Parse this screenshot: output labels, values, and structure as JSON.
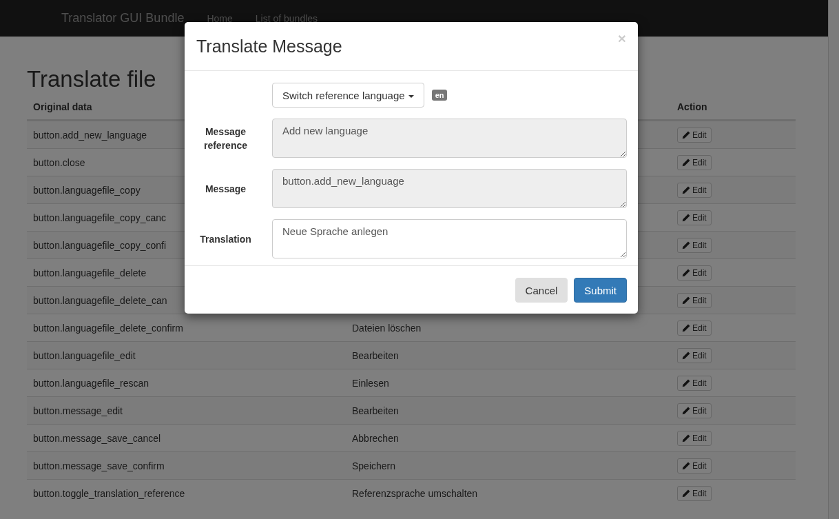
{
  "navbar": {
    "brand": "Translator GUI Bundle",
    "links": [
      {
        "label": "Home"
      },
      {
        "label": "List of bundles"
      }
    ]
  },
  "page": {
    "title": "Translate file",
    "table": {
      "columns": [
        {
          "label": "Original data"
        },
        {
          "label": "Action"
        }
      ],
      "rows": [
        {
          "original": "button.add_new_language",
          "action": "Edit"
        },
        {
          "original": "button.close",
          "action": "Edit"
        },
        {
          "original": "button.languagefile_copy",
          "action": "Edit"
        },
        {
          "original": "button.languagefile_copy_canc",
          "action": "Edit"
        },
        {
          "original": "button.languagefile_copy_confi",
          "action": "Edit"
        },
        {
          "original": "button.languagefile_delete",
          "action": "Edit"
        },
        {
          "original": "button.languagefile_delete_can",
          "action": "Edit"
        },
        {
          "original": "button.languagefile_delete_confirm",
          "translation": "Dateien löschen",
          "action": "Edit"
        },
        {
          "original": "button.languagefile_edit",
          "translation": "Bearbeiten",
          "action": "Edit"
        },
        {
          "original": "button.languagefile_rescan",
          "translation": "Einlesen",
          "action": "Edit"
        },
        {
          "original": "button.message_edit",
          "translation": "Bearbeiten",
          "action": "Edit"
        },
        {
          "original": "button.message_save_cancel",
          "translation": "Abbrechen",
          "action": "Edit"
        },
        {
          "original": "button.message_save_confirm",
          "translation": "Speichern",
          "action": "Edit"
        },
        {
          "original": "button.toggle_translation_reference",
          "translation": "Referenzsprache umschalten",
          "action": "Edit"
        }
      ]
    }
  },
  "modal": {
    "title": "Translate Message",
    "close": "×",
    "reference_switch": {
      "label": "Switch reference language",
      "badge": "en"
    },
    "fields": [
      {
        "label": "Message reference",
        "value": "Add new language",
        "disabled": true
      },
      {
        "label": "Message",
        "value": "button.add_new_language",
        "disabled": true
      },
      {
        "label": "Translation",
        "value": "Neue Sprache anlegen",
        "disabled": false
      }
    ],
    "buttons": [
      {
        "label": "Cancel",
        "kind": "default"
      },
      {
        "label": "Submit",
        "kind": "primary"
      }
    ]
  }
}
